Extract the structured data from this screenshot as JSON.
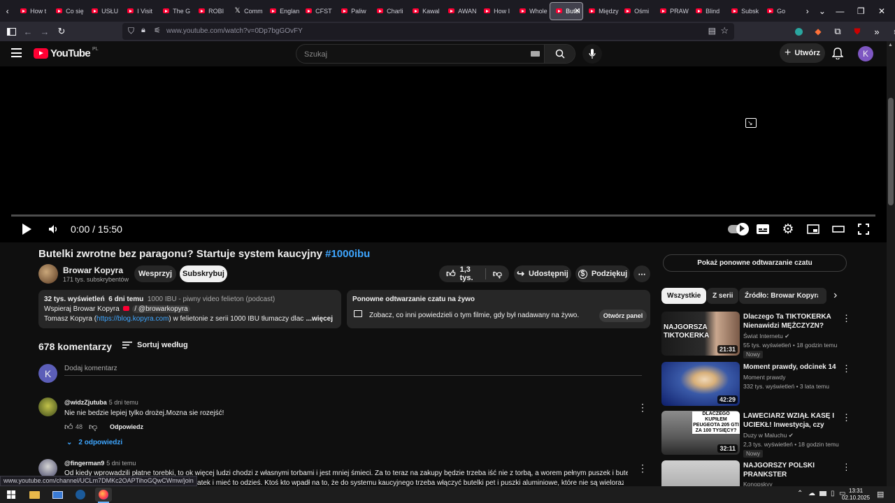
{
  "browser": {
    "tabs": [
      {
        "label": "How t",
        "icon": "youtube"
      },
      {
        "label": "Co się",
        "icon": "youtube"
      },
      {
        "label": "USŁU",
        "icon": "youtube"
      },
      {
        "label": "I Visit",
        "icon": "youtube"
      },
      {
        "label": "The G",
        "icon": "youtube"
      },
      {
        "label": "ROBI",
        "icon": "youtube"
      },
      {
        "label": "Comm",
        "icon": "x"
      },
      {
        "label": "Englan",
        "icon": "youtube"
      },
      {
        "label": "CFST",
        "icon": "youtube"
      },
      {
        "label": "Paliw",
        "icon": "youtube"
      },
      {
        "label": "Charli",
        "icon": "youtube"
      },
      {
        "label": "Kawal",
        "icon": "youtube"
      },
      {
        "label": "AWAN",
        "icon": "youtube"
      },
      {
        "label": "How I",
        "icon": "youtube"
      },
      {
        "label": "Whole",
        "icon": "youtube"
      },
      {
        "label": "Butel",
        "icon": "youtube",
        "active": true
      },
      {
        "label": "Między",
        "icon": "youtube"
      },
      {
        "label": "Ośmi",
        "icon": "youtube"
      },
      {
        "label": "PRAW",
        "icon": "youtube"
      },
      {
        "label": "Blind",
        "icon": "youtube"
      },
      {
        "label": "Subsk",
        "icon": "youtube"
      },
      {
        "label": "Go",
        "icon": "youtube"
      }
    ],
    "url": "www.youtube.com/watch?v=0Dp7bgGOvFY",
    "status_url": "www.youtube.com/channel/UCLm7DMKc2OAPTihoGQwCWmw/join"
  },
  "header": {
    "logo": "YouTube",
    "region": "PL",
    "search_placeholder": "Szukaj",
    "create_label": "Utwórz",
    "avatar_letter": "K"
  },
  "player": {
    "time": "0:00 / 15:50",
    "progress": 0
  },
  "video": {
    "title": "Butelki zwrotne bez paragonu? Startuje system kaucyjny ",
    "hashtag": "#1000ibu",
    "channel": "Browar Kopyra",
    "subscribers": "171 tys. subskrybentów",
    "join_label": "Wesprzyj",
    "subscribe_label": "Subskrybuj",
    "likes": "1,3 tys.",
    "share_label": "Udostępnij",
    "thanks_label": "Podziękuj"
  },
  "description": {
    "views": "32 tys. wyświetleń",
    "date": "6 dni temu",
    "subtitle": "1000 IBU - piwny video felieton (podcast)",
    "line1": "Wspieraj Browar Kopyra",
    "handle": "/ @browarkopyra",
    "line2_pre": "Tomasz Kopyra (",
    "line2_link": "https://blog.kopyra.com",
    "line2_post": ") w felietonie z serii 1000 IBU tłumaczy dlaczego p",
    "more": "...więcej"
  },
  "chat_replay": {
    "title": "Ponowne odtwarzanie czatu na żywo",
    "text": "Zobacz, co inni powiedzieli o tym filmie, gdy był nadawany na żywo.",
    "button": "Otwórz panel"
  },
  "comments": {
    "count": "678 komentarzy",
    "sort_label": "Sortuj według",
    "add_placeholder": "Dodaj komentarz",
    "my_avatar": "K",
    "items": [
      {
        "author": "@widzZjutuba",
        "time": "5 dni temu",
        "text": "Nie nie bedzie lepiej tylko drożej.Mozna sie rozejść!",
        "likes": "48",
        "reply_label": "Odpowiedz",
        "replies": "2 odpowiedzi"
      },
      {
        "author": "@fingerman9",
        "time": "5 dni temu",
        "text": "Od kiedy wprowadzili płatne torebki, to ok więcej ludzi chodzi z własnymi torbami i jest mniej śmieci. Za to teraz na zakupy będzie trzeba iść nie z torbą, a worem pełnym puszek i butelek jak jakiś",
        "text2": "ny podatek i mieć to odzieś. Ktoś kto wpadł na to, że do systemu kaucyjnego trzeba włączyć butelki pet i puszki aluminiowe, które nie są wielorazowe i w"
      }
    ]
  },
  "sidebar": {
    "replay_chat": "Pokaż ponowne odtwarzanie czatu",
    "chips": [
      "Wszystkie",
      "Z serii",
      "Źródło: Browar Kopyra"
    ],
    "recs": [
      {
        "title": "Dlaczego Ta TIKTOKERKA Nienawidzi MĘŻCZYZN?",
        "channel": "Świat Internetu",
        "meta": "55 tys. wyświetleń • 18 godzin temu",
        "duration": "21:31",
        "badge": "Nowy",
        "thumb_text": "NAJGORSZA TIKTOKERKA"
      },
      {
        "title": "Moment prawdy, odcinek 14",
        "channel": "Moment prawdy",
        "meta": "332 tys. wyświetleń • 3 lata temu",
        "duration": "42:29"
      },
      {
        "title": "LAWECIARZ WZIĄŁ KASĘ I UCIEKŁ! Inwestycja, czy strata ...",
        "channel": "Duzy w Maluchu",
        "meta": "2,3 tys. wyświetleń • 18 godzin temu",
        "duration": "32:11",
        "badge": "Nowy",
        "thumb_text": "DLACZEGO KUPIŁEM PEUGEOTA 205 GTI ZA 100 TYSIĘCY?"
      },
      {
        "title": "NAJGORSZY POLSKI PRANKSTER",
        "channel": "Konopskyy"
      }
    ]
  },
  "taskbar": {
    "time": "13:31",
    "date": "02.10.2025"
  }
}
